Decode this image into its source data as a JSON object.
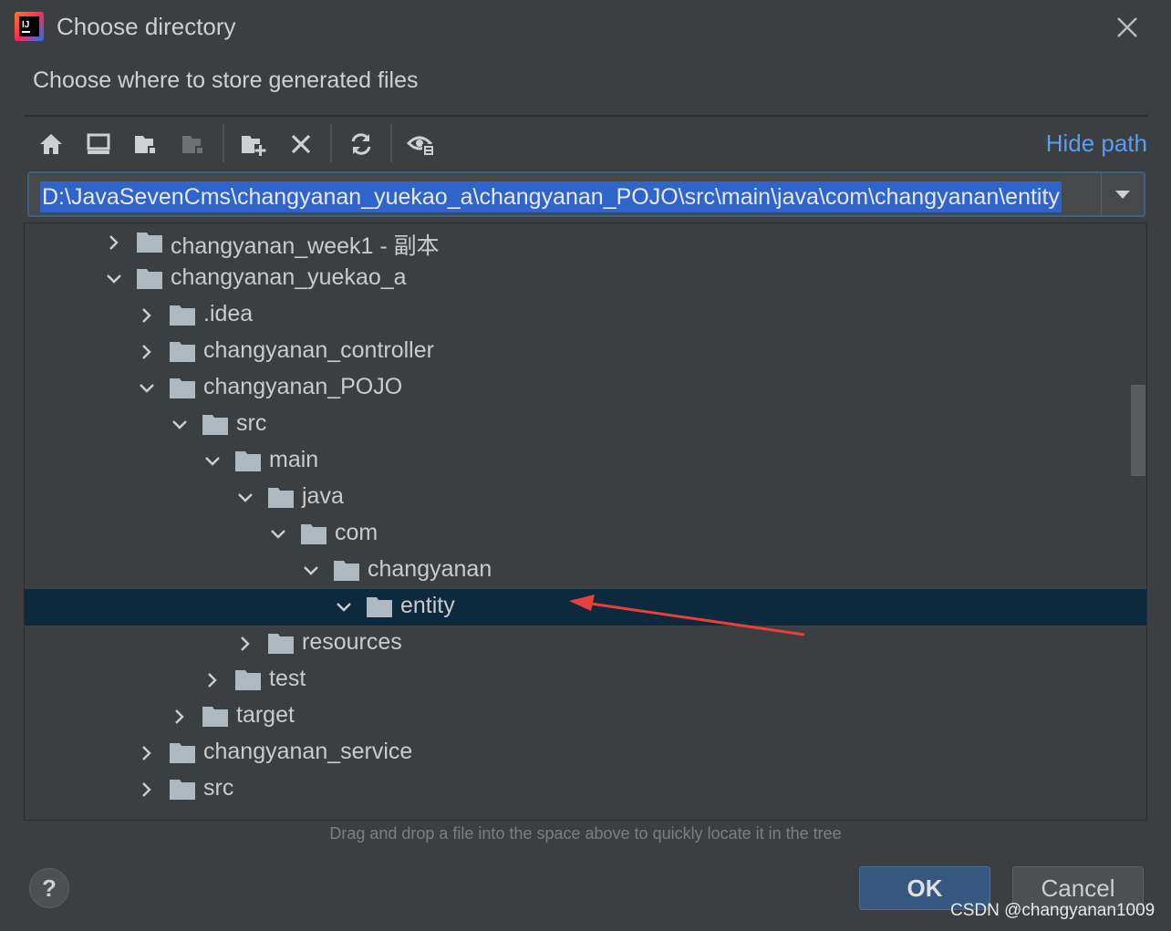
{
  "window": {
    "title": "Choose directory",
    "subtitle": "Choose where to store generated files"
  },
  "toolbar": {
    "buttons": [
      "home-icon",
      "desktop-icon",
      "project-folder-icon",
      "module-folder-icon",
      "new-folder-icon",
      "delete-icon",
      "refresh-icon",
      "show-hidden-icon"
    ],
    "hide_path_label": "Hide path"
  },
  "path": {
    "value": "D:\\JavaSevenCms\\changyanan_yuekao_a\\changyanan_POJO\\src\\main\\java\\com\\changyanan\\entity"
  },
  "tree": {
    "rows": [
      {
        "label": "changyanan_week1 - 副本",
        "expanded": false,
        "depth": 0
      },
      {
        "label": "changyanan_yuekao_a",
        "expanded": true,
        "depth": 0
      },
      {
        "label": ".idea",
        "expanded": false,
        "depth": 1
      },
      {
        "label": "changyanan_controller",
        "expanded": false,
        "depth": 1
      },
      {
        "label": "changyanan_POJO",
        "expanded": true,
        "depth": 1
      },
      {
        "label": "src",
        "expanded": true,
        "depth": 2
      },
      {
        "label": "main",
        "expanded": true,
        "depth": 3
      },
      {
        "label": "java",
        "expanded": true,
        "depth": 4
      },
      {
        "label": "com",
        "expanded": true,
        "depth": 5
      },
      {
        "label": "changyanan",
        "expanded": true,
        "depth": 6
      },
      {
        "label": "entity",
        "expanded": true,
        "depth": 7,
        "selected": true
      },
      {
        "label": "resources",
        "expanded": false,
        "depth": 4
      },
      {
        "label": "test",
        "expanded": false,
        "depth": 3
      },
      {
        "label": "target",
        "expanded": false,
        "depth": 2
      },
      {
        "label": "changyanan_service",
        "expanded": false,
        "depth": 1
      },
      {
        "label": "src",
        "expanded": false,
        "depth": 1
      }
    ]
  },
  "hint": "Drag and drop a file into the space above to quickly locate it in the tree",
  "buttons": {
    "help": "?",
    "ok": "OK",
    "cancel": "Cancel"
  },
  "watermark": "CSDN @changyanan1009",
  "colors": {
    "background": "#3c3f41",
    "accent_link": "#589df6",
    "selection": "#0d293e",
    "ok_button": "#365880",
    "annotation_arrow": "#e8403a"
  }
}
